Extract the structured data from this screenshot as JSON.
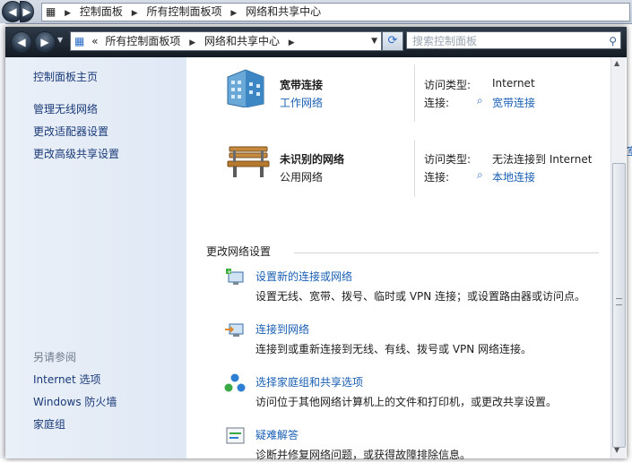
{
  "back_window": {
    "breadcrumbs": [
      "控制面板",
      "所有控制面板项",
      "网络和共享中心"
    ]
  },
  "toolbar": {
    "address_prefix": "«",
    "address_crumbs": [
      "所有控制面板项",
      "网络和共享中心"
    ],
    "refresh_icon": "refresh-icon",
    "search_placeholder": "搜索控制面板"
  },
  "sidebar": {
    "links": [
      "控制面板主页",
      "管理无线网络",
      "更改适配器设置",
      "更改高级共享设置"
    ],
    "see_also_heading": "另请参阅",
    "see_also": [
      "Internet 选项",
      "Windows 防火墙",
      "家庭组"
    ]
  },
  "networks": [
    {
      "icon": "office-building-icon",
      "name": "宽带连接",
      "type": "工作网络",
      "access_label": "访问类型:",
      "access_value": "Internet",
      "conn_label": "连接:",
      "conn_value": "宽带连接"
    },
    {
      "icon": "park-bench-icon",
      "name": "未识别的网络",
      "type": "公用网络",
      "access_label": "访问类型:",
      "access_value": "无法连接到 Internet",
      "conn_label": "连接:",
      "conn_value": "本地连接"
    }
  ],
  "change_settings": {
    "heading": "更改网络设置",
    "tasks": [
      {
        "icon": "new-connection-icon",
        "title": "设置新的连接或网络",
        "desc": "设置无线、宽带、拨号、临时或 VPN 连接；或设置路由器或访问点。"
      },
      {
        "icon": "connect-to-network-icon",
        "title": "连接到网络",
        "desc": "连接到或重新连接到无线、有线、拨号或 VPN 网络连接。"
      },
      {
        "icon": "homegroup-icon",
        "title": "选择家庭组和共享选项",
        "desc": "访问位于其他网络计算机上的文件和打印机，或更改共享设置。"
      },
      {
        "icon": "troubleshoot-icon",
        "title": "疑难解答",
        "desc": "诊断并修复网络问题，或获得故障排除信息。"
      }
    ]
  },
  "right_peek": "室"
}
